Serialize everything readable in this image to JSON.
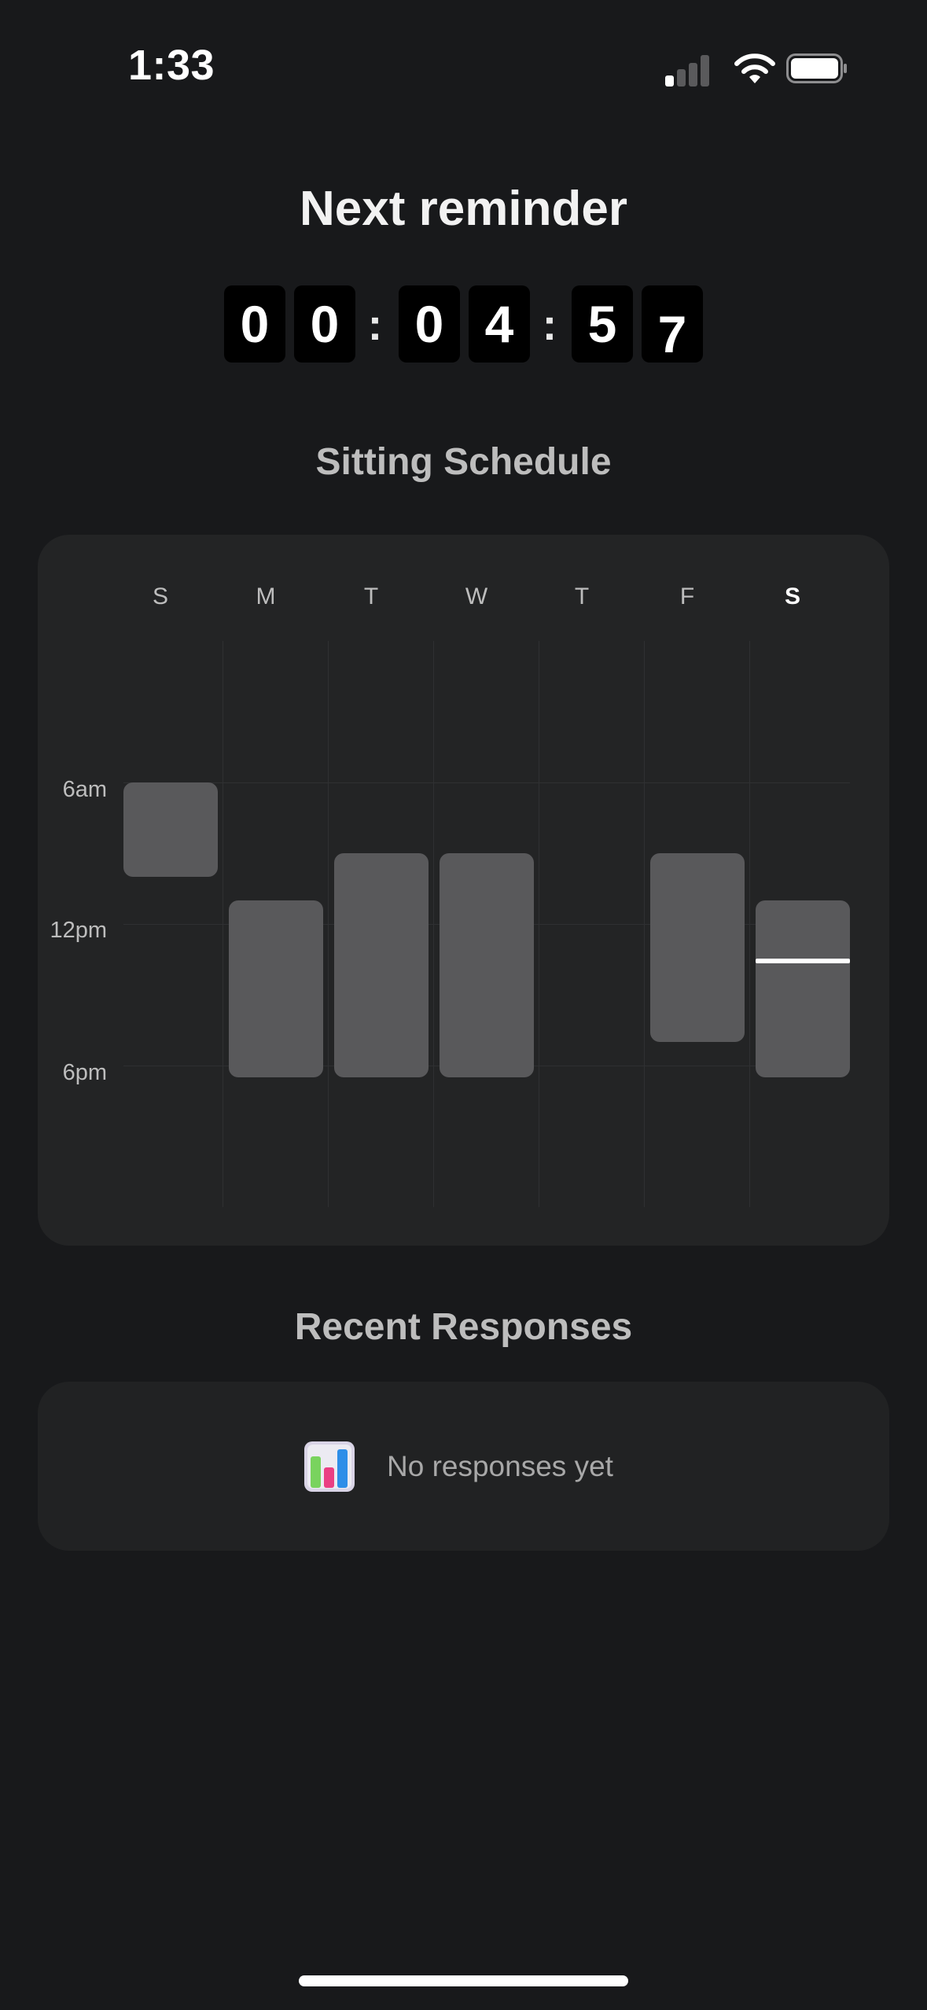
{
  "status_bar": {
    "time": "1:33"
  },
  "reminder": {
    "title": "Next reminder",
    "countdown": [
      "0",
      "0",
      ":",
      "0",
      "4",
      ":",
      "5",
      "7"
    ]
  },
  "schedule": {
    "title": "Sitting Schedule",
    "days": [
      "S",
      "M",
      "T",
      "W",
      "T",
      "F",
      "S"
    ],
    "today_index": 6,
    "time_labels": [
      "6am",
      "12pm",
      "6pm"
    ],
    "blocks": [
      {
        "day": "S",
        "start_hour": 6.0,
        "end_hour": 10.0
      },
      {
        "day": "M",
        "start_hour": 11.0,
        "end_hour": 18.5
      },
      {
        "day": "T",
        "start_hour": 9.0,
        "end_hour": 18.5
      },
      {
        "day": "W",
        "start_hour": 9.0,
        "end_hour": 18.5
      },
      {
        "day": "F",
        "start_hour": 9.0,
        "end_hour": 17.0
      },
      {
        "day": "S",
        "start_hour": 11.0,
        "end_hour": 18.5
      }
    ],
    "current_time_hour": 13.55
  },
  "responses": {
    "title": "Recent Responses",
    "empty_text": "No responses yet",
    "empty_icon": "bar-chart-icon"
  }
}
